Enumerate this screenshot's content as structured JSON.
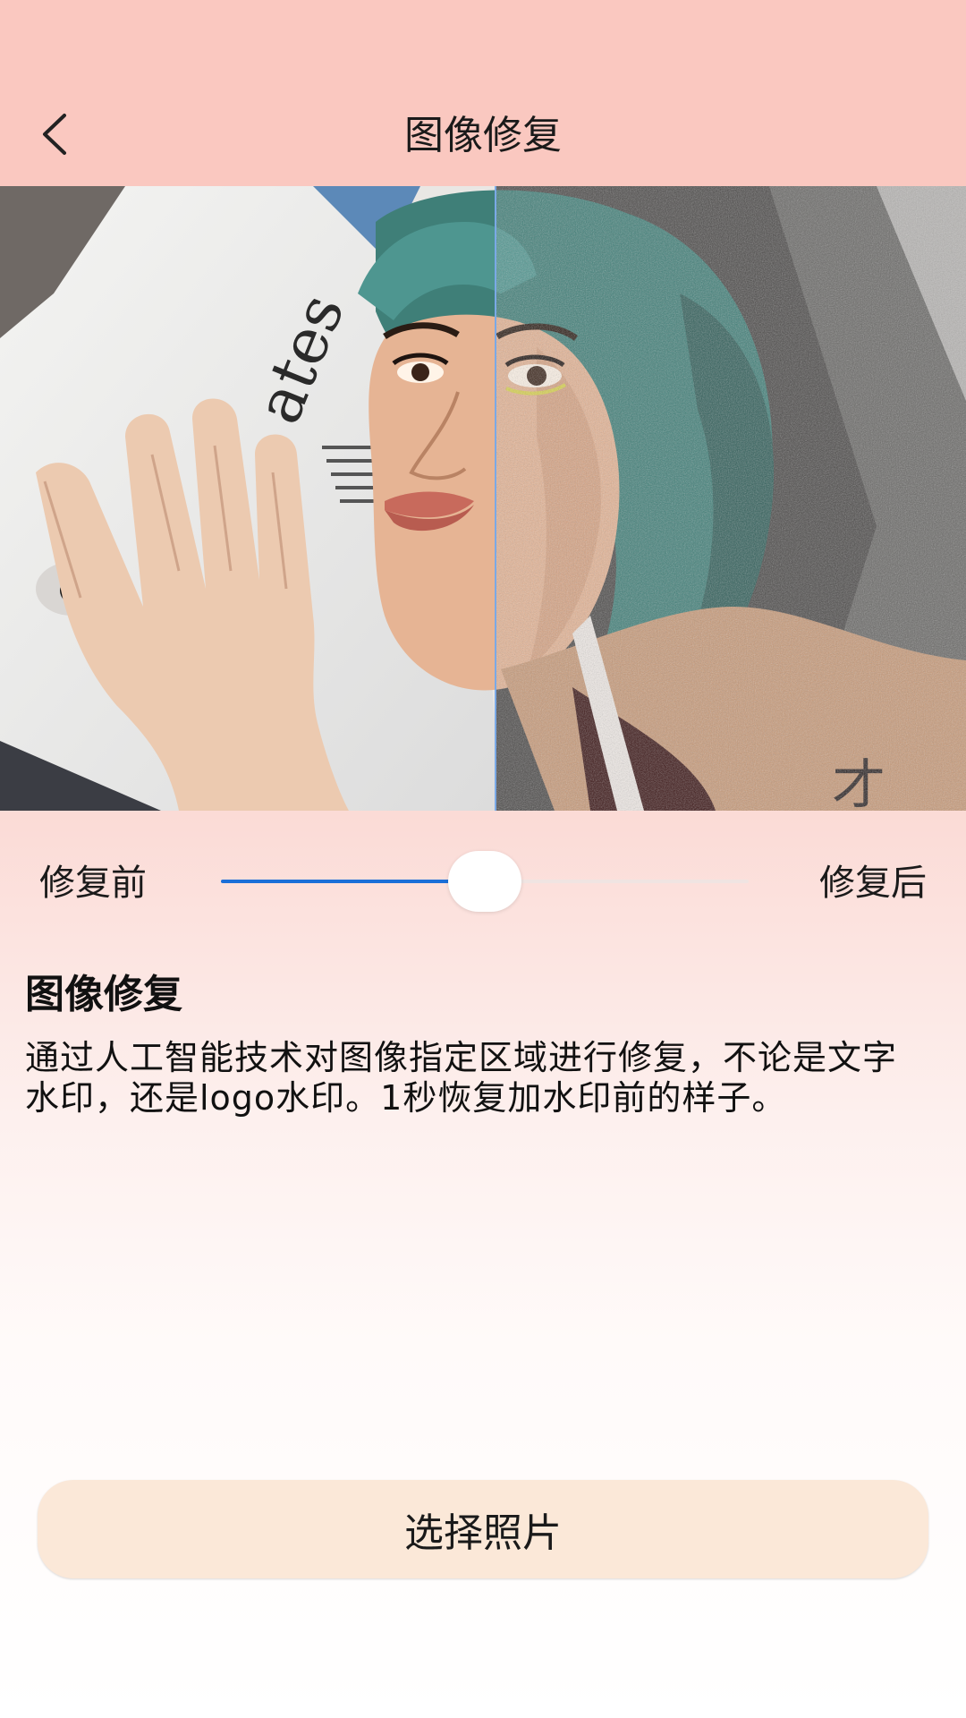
{
  "header": {
    "title": "图像修复",
    "back_icon": "chevron-left-icon"
  },
  "photo": {
    "description_icon": "before-after-photo",
    "split_position": 0.513
  },
  "slider": {
    "before_label": "修复前",
    "after_label": "修复后",
    "value": 0.5
  },
  "info": {
    "title": "图像修复",
    "description": "通过人工智能技术对图像指定区域进行修复，不论是文字水印，还是logo水印。1秒恢复加水印前的样子。"
  },
  "action": {
    "choose_photo_label": "选择照片"
  },
  "colors": {
    "header_bg": "#fac8c0",
    "slider_fill": "#1c6fd8",
    "button_bg": "#fbe8d8"
  }
}
